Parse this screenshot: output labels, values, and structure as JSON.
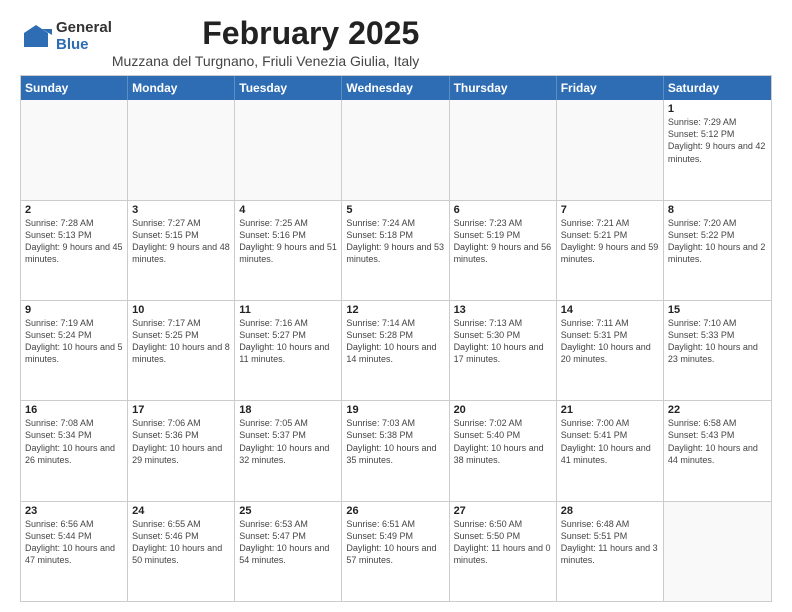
{
  "logo": {
    "general": "General",
    "blue": "Blue"
  },
  "title": {
    "month": "February 2025",
    "location": "Muzzana del Turgnano, Friuli Venezia Giulia, Italy"
  },
  "weekdays": [
    "Sunday",
    "Monday",
    "Tuesday",
    "Wednesday",
    "Thursday",
    "Friday",
    "Saturday"
  ],
  "rows": [
    [
      {
        "day": "",
        "info": ""
      },
      {
        "day": "",
        "info": ""
      },
      {
        "day": "",
        "info": ""
      },
      {
        "day": "",
        "info": ""
      },
      {
        "day": "",
        "info": ""
      },
      {
        "day": "",
        "info": ""
      },
      {
        "day": "1",
        "info": "Sunrise: 7:29 AM\nSunset: 5:12 PM\nDaylight: 9 hours and 42 minutes."
      }
    ],
    [
      {
        "day": "2",
        "info": "Sunrise: 7:28 AM\nSunset: 5:13 PM\nDaylight: 9 hours and 45 minutes."
      },
      {
        "day": "3",
        "info": "Sunrise: 7:27 AM\nSunset: 5:15 PM\nDaylight: 9 hours and 48 minutes."
      },
      {
        "day": "4",
        "info": "Sunrise: 7:25 AM\nSunset: 5:16 PM\nDaylight: 9 hours and 51 minutes."
      },
      {
        "day": "5",
        "info": "Sunrise: 7:24 AM\nSunset: 5:18 PM\nDaylight: 9 hours and 53 minutes."
      },
      {
        "day": "6",
        "info": "Sunrise: 7:23 AM\nSunset: 5:19 PM\nDaylight: 9 hours and 56 minutes."
      },
      {
        "day": "7",
        "info": "Sunrise: 7:21 AM\nSunset: 5:21 PM\nDaylight: 9 hours and 59 minutes."
      },
      {
        "day": "8",
        "info": "Sunrise: 7:20 AM\nSunset: 5:22 PM\nDaylight: 10 hours and 2 minutes."
      }
    ],
    [
      {
        "day": "9",
        "info": "Sunrise: 7:19 AM\nSunset: 5:24 PM\nDaylight: 10 hours and 5 minutes."
      },
      {
        "day": "10",
        "info": "Sunrise: 7:17 AM\nSunset: 5:25 PM\nDaylight: 10 hours and 8 minutes."
      },
      {
        "day": "11",
        "info": "Sunrise: 7:16 AM\nSunset: 5:27 PM\nDaylight: 10 hours and 11 minutes."
      },
      {
        "day": "12",
        "info": "Sunrise: 7:14 AM\nSunset: 5:28 PM\nDaylight: 10 hours and 14 minutes."
      },
      {
        "day": "13",
        "info": "Sunrise: 7:13 AM\nSunset: 5:30 PM\nDaylight: 10 hours and 17 minutes."
      },
      {
        "day": "14",
        "info": "Sunrise: 7:11 AM\nSunset: 5:31 PM\nDaylight: 10 hours and 20 minutes."
      },
      {
        "day": "15",
        "info": "Sunrise: 7:10 AM\nSunset: 5:33 PM\nDaylight: 10 hours and 23 minutes."
      }
    ],
    [
      {
        "day": "16",
        "info": "Sunrise: 7:08 AM\nSunset: 5:34 PM\nDaylight: 10 hours and 26 minutes."
      },
      {
        "day": "17",
        "info": "Sunrise: 7:06 AM\nSunset: 5:36 PM\nDaylight: 10 hours and 29 minutes."
      },
      {
        "day": "18",
        "info": "Sunrise: 7:05 AM\nSunset: 5:37 PM\nDaylight: 10 hours and 32 minutes."
      },
      {
        "day": "19",
        "info": "Sunrise: 7:03 AM\nSunset: 5:38 PM\nDaylight: 10 hours and 35 minutes."
      },
      {
        "day": "20",
        "info": "Sunrise: 7:02 AM\nSunset: 5:40 PM\nDaylight: 10 hours and 38 minutes."
      },
      {
        "day": "21",
        "info": "Sunrise: 7:00 AM\nSunset: 5:41 PM\nDaylight: 10 hours and 41 minutes."
      },
      {
        "day": "22",
        "info": "Sunrise: 6:58 AM\nSunset: 5:43 PM\nDaylight: 10 hours and 44 minutes."
      }
    ],
    [
      {
        "day": "23",
        "info": "Sunrise: 6:56 AM\nSunset: 5:44 PM\nDaylight: 10 hours and 47 minutes."
      },
      {
        "day": "24",
        "info": "Sunrise: 6:55 AM\nSunset: 5:46 PM\nDaylight: 10 hours and 50 minutes."
      },
      {
        "day": "25",
        "info": "Sunrise: 6:53 AM\nSunset: 5:47 PM\nDaylight: 10 hours and 54 minutes."
      },
      {
        "day": "26",
        "info": "Sunrise: 6:51 AM\nSunset: 5:49 PM\nDaylight: 10 hours and 57 minutes."
      },
      {
        "day": "27",
        "info": "Sunrise: 6:50 AM\nSunset: 5:50 PM\nDaylight: 11 hours and 0 minutes."
      },
      {
        "day": "28",
        "info": "Sunrise: 6:48 AM\nSunset: 5:51 PM\nDaylight: 11 hours and 3 minutes."
      },
      {
        "day": "",
        "info": ""
      }
    ]
  ]
}
